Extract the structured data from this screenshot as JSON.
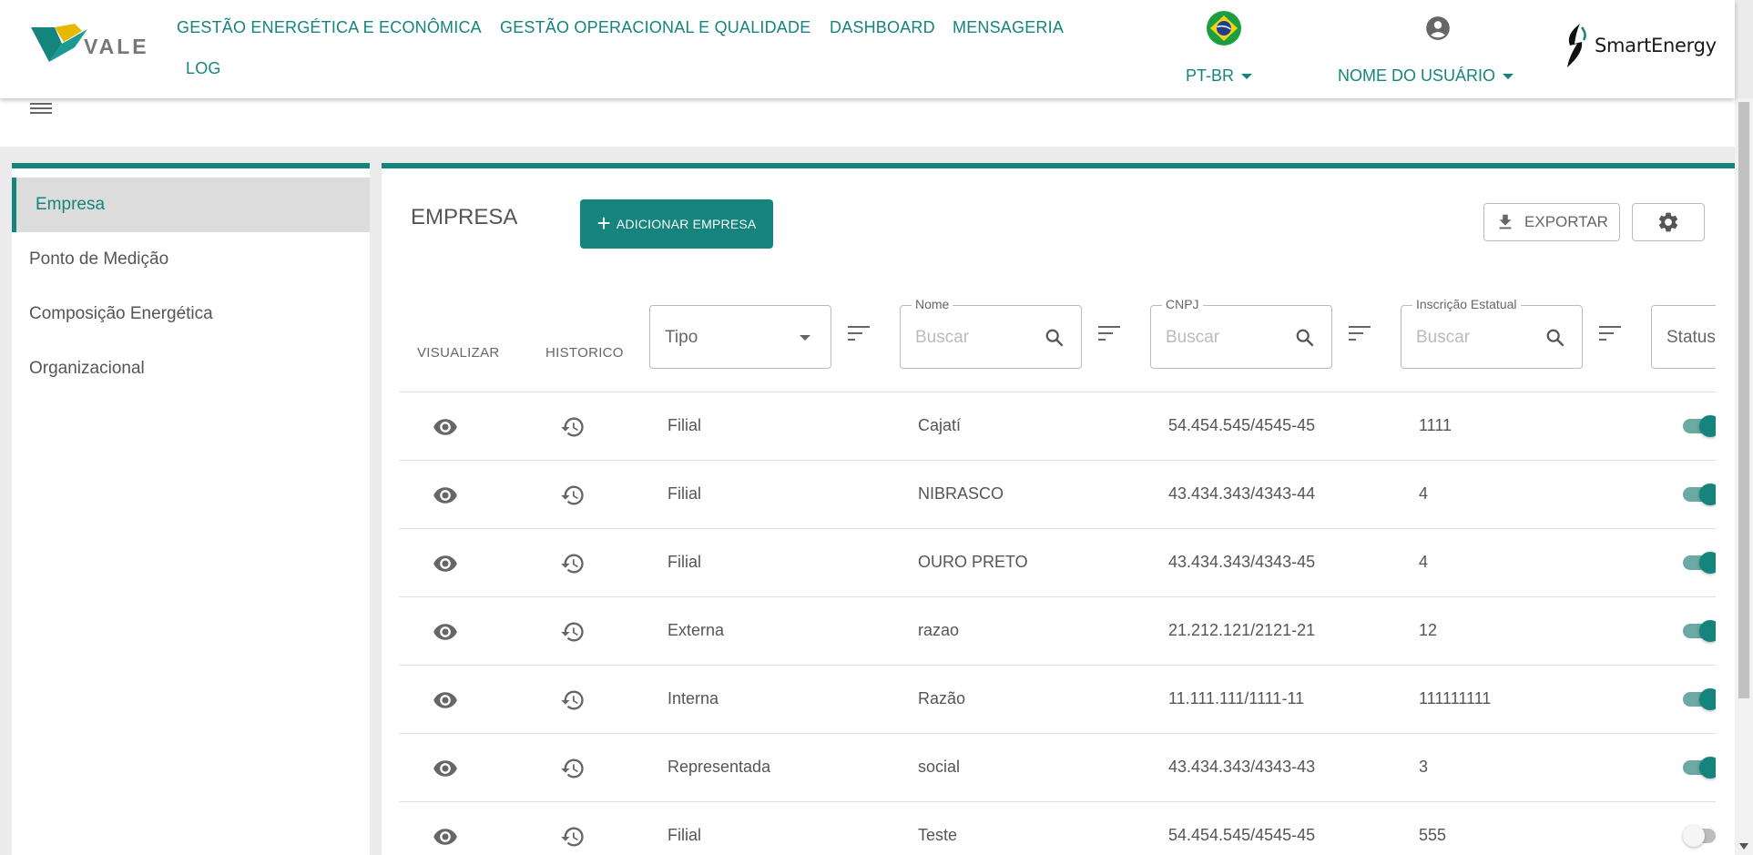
{
  "header": {
    "brand_left": "VALE",
    "nav": [
      "GESTÃO ENERGÉTICA E ECONÔMICA",
      "GESTÃO OPERACIONAL E QUALIDADE",
      "DASHBOARD",
      "MENSAGERIA",
      "LOG"
    ],
    "language": "PT-BR",
    "user_name": "NOME DO USUÁRIO",
    "brand_right": "SmartEnergy"
  },
  "sidebar": {
    "items": [
      {
        "label": "Empresa",
        "active": true
      },
      {
        "label": "Ponto de Medição",
        "active": false
      },
      {
        "label": "Composição Energética",
        "active": false
      },
      {
        "label": "Organizacional",
        "active": false
      }
    ]
  },
  "main": {
    "title": "EMPRESA",
    "add_button": "ADICIONAR EMPRESA",
    "export_button": "EXPORTAR"
  },
  "table": {
    "headers": {
      "view": "VISUALIZAR",
      "history": "HISTORICO"
    },
    "filters": {
      "tipo": {
        "value": "Tipo"
      },
      "nome": {
        "label": "Nome",
        "placeholder": "Buscar"
      },
      "cnpj": {
        "label": "CNPJ",
        "placeholder": "Buscar"
      },
      "ie": {
        "label": "Inscrição Estatual",
        "placeholder": "Buscar"
      },
      "status": {
        "value": "Status"
      }
    },
    "rows": [
      {
        "tipo": "Filial",
        "nome": "Cajatí",
        "cnpj": "54.454.545/4545-45",
        "ie": "1111",
        "status": true
      },
      {
        "tipo": "Filial",
        "nome": "NIBRASCO",
        "cnpj": "43.434.343/4343-44",
        "ie": "4",
        "status": true
      },
      {
        "tipo": "Filial",
        "nome": "OURO PRETO",
        "cnpj": "43.434.343/4343-45",
        "ie": "4",
        "status": true
      },
      {
        "tipo": "Externa",
        "nome": "razao",
        "cnpj": "21.212.121/2121-21",
        "ie": "12",
        "status": true
      },
      {
        "tipo": "Interna",
        "nome": "Razão",
        "cnpj": "11.111.111/1111-11",
        "ie": "111111111",
        "status": true
      },
      {
        "tipo": "Representada",
        "nome": "social",
        "cnpj": "43.434.343/4343-43",
        "ie": "3",
        "status": true
      },
      {
        "tipo": "Filial",
        "nome": "Teste",
        "cnpj": "54.454.545/4545-45",
        "ie": "555",
        "status": false
      }
    ]
  },
  "colors": {
    "accent": "#14847d",
    "background": "#ebebeb"
  }
}
